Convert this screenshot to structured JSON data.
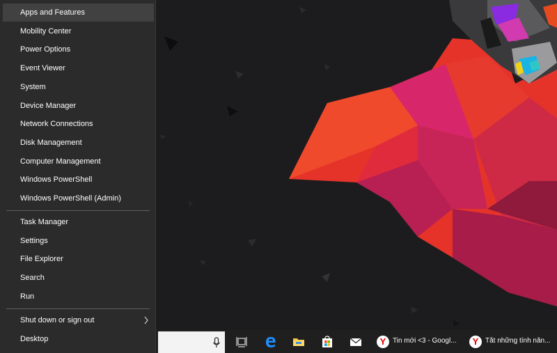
{
  "winx_menu": {
    "group1": [
      {
        "label": "Apps and Features",
        "name": "menu-apps-and-features"
      },
      {
        "label": "Mobility Center",
        "name": "menu-mobility-center"
      },
      {
        "label": "Power Options",
        "name": "menu-power-options"
      },
      {
        "label": "Event Viewer",
        "name": "menu-event-viewer"
      },
      {
        "label": "System",
        "name": "menu-system"
      },
      {
        "label": "Device Manager",
        "name": "menu-device-manager"
      },
      {
        "label": "Network Connections",
        "name": "menu-network-connections"
      },
      {
        "label": "Disk Management",
        "name": "menu-disk-management"
      },
      {
        "label": "Computer Management",
        "name": "menu-computer-management"
      },
      {
        "label": "Windows PowerShell",
        "name": "menu-windows-powershell"
      },
      {
        "label": "Windows PowerShell (Admin)",
        "name": "menu-windows-powershell-admin"
      }
    ],
    "group2": [
      {
        "label": "Task Manager",
        "name": "menu-task-manager"
      },
      {
        "label": "Settings",
        "name": "menu-settings"
      },
      {
        "label": "File Explorer",
        "name": "menu-file-explorer"
      },
      {
        "label": "Search",
        "name": "menu-search"
      },
      {
        "label": "Run",
        "name": "menu-run"
      }
    ],
    "group3": [
      {
        "label": "Shut down or sign out",
        "name": "menu-shut-down-or-sign-out"
      },
      {
        "label": "Desktop",
        "name": "menu-desktop"
      }
    ]
  },
  "taskbar": {
    "icons": [
      "task-view-icon",
      "edge-icon",
      "file-explorer-icon",
      "store-icon",
      "mail-icon"
    ],
    "apps": [
      {
        "label": "Tin mới <3 - Googl...",
        "icon": "yandex-browser-icon"
      },
      {
        "label": "Tắt những tính năn...",
        "icon": "yandex-browser-icon"
      }
    ],
    "yandex_letter": "Y"
  },
  "colors": {
    "menu_bg": "#2b2b2b",
    "menu_hover": "#414141",
    "taskbar_bg": "#1f1f1f",
    "wallpaper_red": "#e5332a",
    "wallpaper_magenta": "#c7245e"
  }
}
